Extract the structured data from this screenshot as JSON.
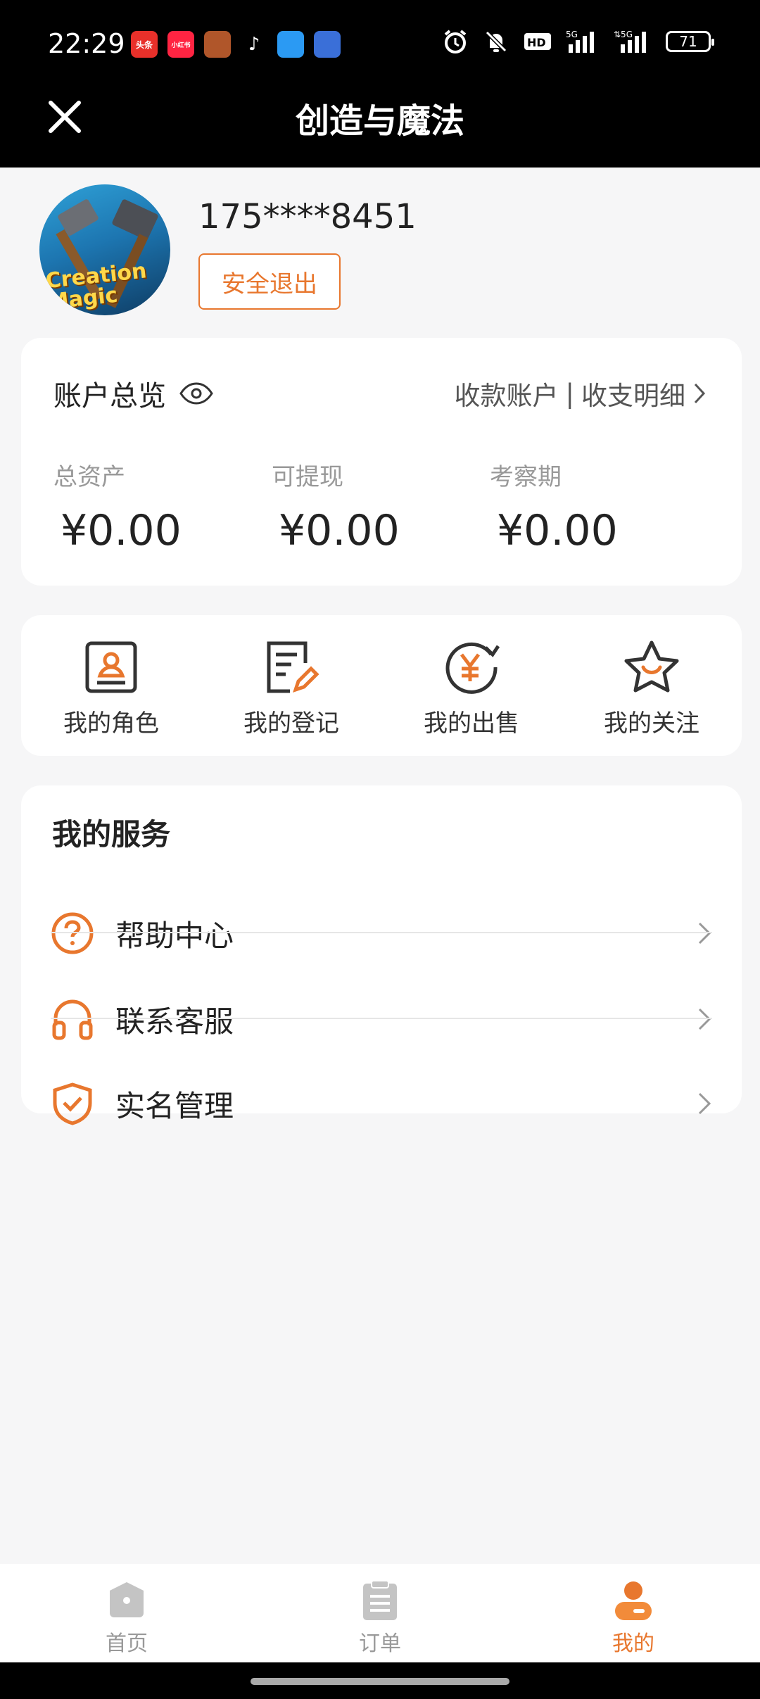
{
  "status_bar": {
    "time": "22:29",
    "apps": [
      {
        "name": "toutiao-icon",
        "text": "头条",
        "color": "#e8302a"
      },
      {
        "name": "xiaohongshu-icon",
        "text": "小红书",
        "color": "#ff2442"
      },
      {
        "name": "game-icon",
        "text": "",
        "color": "#b0562a"
      },
      {
        "name": "tiktok-icon",
        "text": "♪",
        "color": "#000000"
      },
      {
        "name": "cloud-app-icon",
        "text": "",
        "color": "#2b9af3"
      },
      {
        "name": "tool-app-icon",
        "text": "",
        "color": "#3a6fd8"
      }
    ],
    "battery": "71"
  },
  "header": {
    "title": "创造与魔法"
  },
  "profile": {
    "avatar_text": "Creation Magic",
    "phone": "175****8451",
    "logout_label": "安全退出"
  },
  "account": {
    "title": "账户总览",
    "links": {
      "receive": "收款账户",
      "separator": "|",
      "detail": "收支明细"
    },
    "columns": [
      {
        "label": "总资产",
        "value": "¥0.00"
      },
      {
        "label": "可提现",
        "value": "¥0.00"
      },
      {
        "label": "考察期",
        "value": "¥0.00"
      }
    ]
  },
  "quick_actions": [
    {
      "label": "我的角色",
      "icon": "role-card-icon"
    },
    {
      "label": "我的登记",
      "icon": "edit-note-icon"
    },
    {
      "label": "我的出售",
      "icon": "yuan-sale-icon"
    },
    {
      "label": "我的关注",
      "icon": "star-icon"
    }
  ],
  "services": {
    "title": "我的服务",
    "items": [
      {
        "label": "帮助中心",
        "icon": "help-icon"
      },
      {
        "label": "联系客服",
        "icon": "headset-icon"
      },
      {
        "label": "实名管理",
        "icon": "shield-check-icon"
      }
    ]
  },
  "tab_bar": {
    "items": [
      {
        "label": "首页",
        "icon": "home-icon",
        "active": false
      },
      {
        "label": "订单",
        "icon": "order-icon",
        "active": false
      },
      {
        "label": "我的",
        "icon": "profile-icon",
        "active": true
      }
    ]
  },
  "colors": {
    "accent": "#e8772e",
    "text": "#222222",
    "muted": "#999999",
    "bg": "#f6f6f7"
  }
}
